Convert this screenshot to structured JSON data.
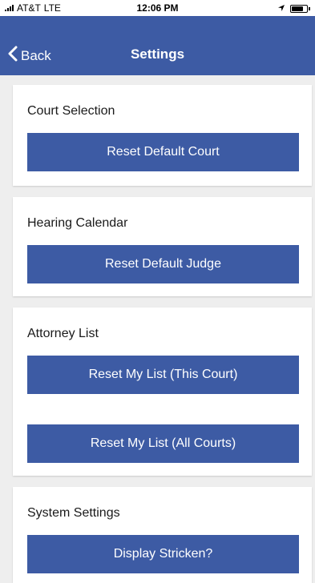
{
  "status_bar": {
    "carrier": "AT&T",
    "network": "LTE",
    "time": "12:06 PM"
  },
  "nav": {
    "back_label": "Back",
    "title": "Settings"
  },
  "sections": [
    {
      "title": "Court Selection",
      "buttons": [
        "Reset Default Court"
      ]
    },
    {
      "title": "Hearing Calendar",
      "buttons": [
        "Reset Default Judge"
      ]
    },
    {
      "title": "Attorney List",
      "buttons": [
        "Reset My List (This Court)",
        "Reset My List (All Courts)"
      ]
    },
    {
      "title": "System Settings",
      "buttons": [
        "Display Stricken?"
      ]
    }
  ],
  "colors": {
    "nav_bg": "#3d5ba4",
    "button_bg": "#3d5ba4",
    "page_bg": "#eeeeee"
  }
}
